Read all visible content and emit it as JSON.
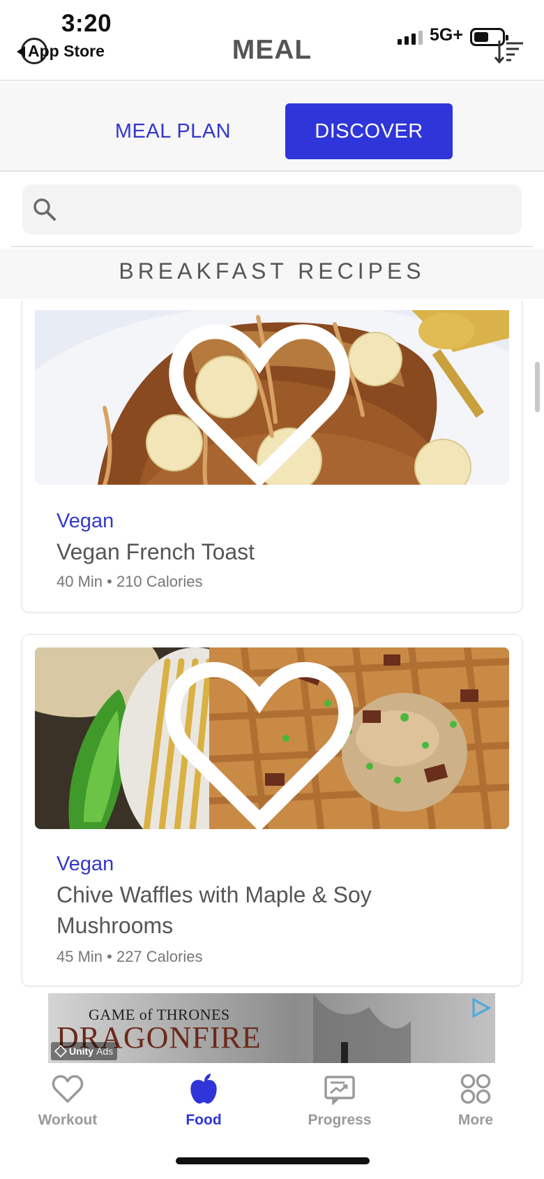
{
  "status_bar": {
    "time": "3:20",
    "back_label": "App Store",
    "network": "5G+"
  },
  "header": {
    "title": "MEAL",
    "sort_icon": "sort-icon"
  },
  "tabs": [
    {
      "label": "MEAL PLAN",
      "active": false
    },
    {
      "label": "DISCOVER",
      "active": true
    }
  ],
  "search": {
    "placeholder": "",
    "icon": "search-icon"
  },
  "section": {
    "title": "BREAKFAST RECIPES"
  },
  "recipes": [
    {
      "tag": "Vegan",
      "name": "Vegan French Toast",
      "meta": "40 Min • 210 Calories",
      "favorite": false
    },
    {
      "tag": "Vegan",
      "name": "Chive Waffles with Maple & Soy Mushrooms",
      "meta": "45 Min • 227 Calories",
      "favorite": false
    }
  ],
  "ad": {
    "line1": "GAME of THRONES",
    "line2": "DRAGONFIRE",
    "badge_brand": "Unity",
    "badge_text": "Ads"
  },
  "bottom_nav": [
    {
      "label": "Workout",
      "icon": "heart-icon",
      "active": false
    },
    {
      "label": "Food",
      "icon": "apple-icon",
      "active": true
    },
    {
      "label": "Progress",
      "icon": "chart-card-icon",
      "active": false
    },
    {
      "label": "More",
      "icon": "grid-icon",
      "active": false
    }
  ],
  "colors": {
    "accent": "#2f35d8",
    "tag": "#3338c9",
    "inactive": "#9a9a9a"
  }
}
